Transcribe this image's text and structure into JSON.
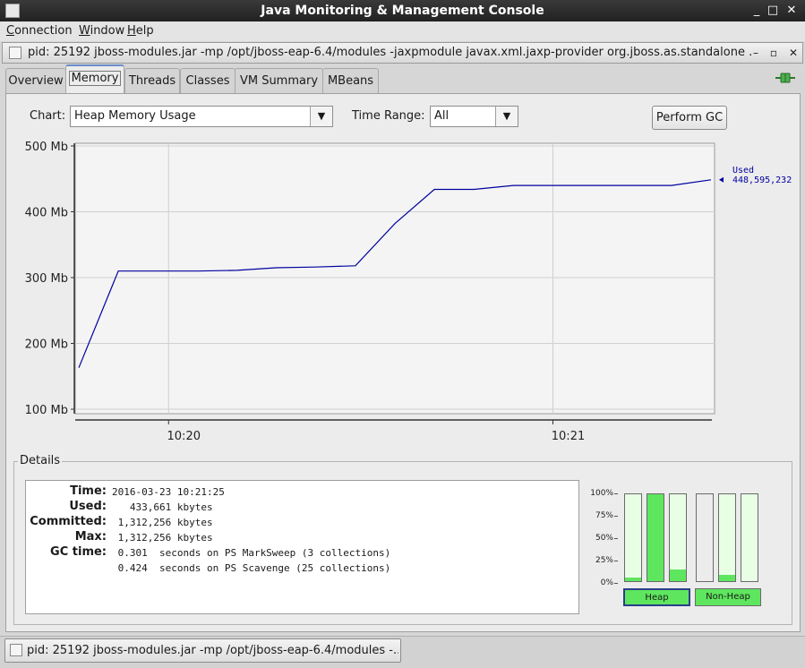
{
  "window": {
    "title": "Java Monitoring & Management Console",
    "buttons": {
      "minimize": "_",
      "maximize": "□",
      "close": "✕"
    }
  },
  "menubar": {
    "items": [
      {
        "label": "Connection",
        "mnemonic": "C",
        "rest": "onnection"
      },
      {
        "label": "Window",
        "mnemonic": "W",
        "rest": "indow"
      },
      {
        "label": "Help",
        "mnemonic": "H",
        "rest": "elp"
      }
    ]
  },
  "internal_frame": {
    "title": "pid: 25192 jboss-modules.jar -mp /opt/jboss-eap-6.4/modules -jaxpmodule javax.xml.jaxp-provider org.jboss.as.standalone ...",
    "buttons": {
      "minimize": "–",
      "maximize": "▫",
      "close": "✕"
    }
  },
  "tabs": [
    {
      "label": "Overview",
      "selected": false
    },
    {
      "label": "Memory",
      "selected": true
    },
    {
      "label": "Threads",
      "selected": false
    },
    {
      "label": "Classes",
      "selected": false
    },
    {
      "label": "VM Summary",
      "selected": false
    },
    {
      "label": "MBeans",
      "selected": false
    }
  ],
  "controls": {
    "chart_label": "Chart:",
    "chart_value": "Heap Memory Usage",
    "time_range_label": "Time Range:",
    "time_range_value": "All",
    "perform_gc_label": "Perform GC"
  },
  "chart_data": {
    "type": "line",
    "x": [
      "10:19:48",
      "10:19:54",
      "10:20:00",
      "10:20:06",
      "10:20:12",
      "10:20:18",
      "10:20:24",
      "10:20:30",
      "10:20:36",
      "10:20:42",
      "10:20:48",
      "10:20:54",
      "10:21:00",
      "10:21:06",
      "10:21:12",
      "10:21:18",
      "10:21:25"
    ],
    "series": [
      {
        "name": "Used",
        "values": [
          163,
          310,
          310,
          310,
          311,
          315,
          316,
          318,
          382,
          434,
          434,
          440,
          440,
          440,
          440,
          440,
          448.6
        ]
      }
    ],
    "ylim": [
      100,
      500
    ],
    "y_ticks": [
      "500 Mb",
      "400 Mb",
      "300 Mb",
      "200 Mb",
      "100 Mb"
    ],
    "x_ticks": [
      "10:20",
      "10:21"
    ],
    "legend": {
      "label": "Used",
      "value": "448,595,232",
      "position": "right"
    },
    "grid": true,
    "line_color": "#0000a0"
  },
  "details": {
    "title": "Details",
    "rows": [
      {
        "key": "Time:",
        "value": "2016-03-23 10:21:25"
      },
      {
        "key": "Used:",
        "value": "   433,661 kbytes"
      },
      {
        "key": "Committed:",
        "value": " 1,312,256 kbytes"
      },
      {
        "key": "Max:",
        "value": " 1,312,256 kbytes"
      },
      {
        "key": "GC time:",
        "value": " 0.301  seconds on PS MarkSweep (3 collections)"
      },
      {
        "key": "",
        "value": " 0.424  seconds on PS Scavenge (25 collections)"
      }
    ]
  },
  "pools": {
    "percent_labels": [
      "100%",
      "75%",
      "50%",
      "25%",
      "0%"
    ],
    "heap_label": "Heap",
    "nonheap_label": "Non-Heap",
    "heap_fills": [
      0.04,
      1.0,
      0.13
    ],
    "nonheap_fills": [
      0.0,
      0.07,
      0.0
    ],
    "fill_color": "#5ee65e"
  },
  "taskbar": {
    "item_label": "pid: 25192 jboss-modules.jar -mp /opt/jboss-eap-6.4/modules -..."
  }
}
